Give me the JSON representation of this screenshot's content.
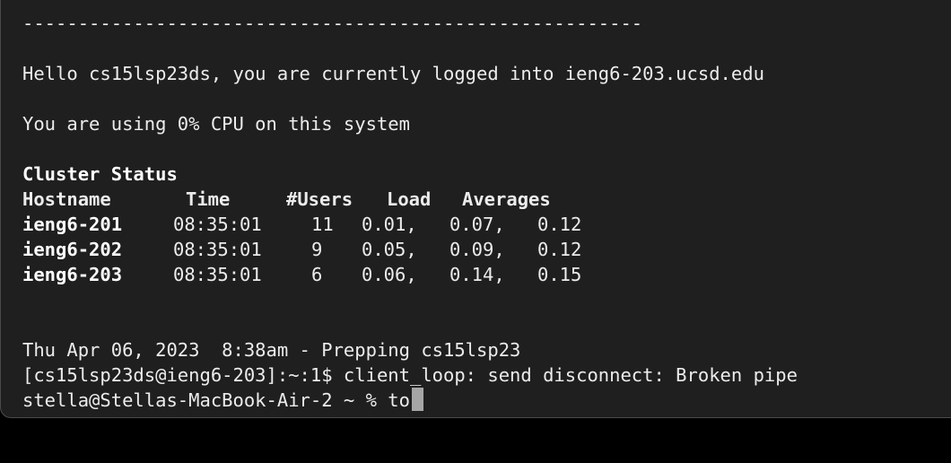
{
  "terminal": {
    "divider": "--------------------------------------------------------",
    "greeting": "Hello cs15lsp23ds, you are currently logged into ieng6-203.ucsd.edu",
    "cpu_usage": "You are using 0% CPU on this system",
    "cluster_title": "Cluster Status",
    "cluster_headers": {
      "hostname": "Hostname",
      "time": "Time",
      "users": "#Users",
      "load": "Load",
      "averages": "Averages"
    },
    "cluster_rows": [
      {
        "host": "ieng6-201",
        "time": "08:35:01",
        "users": "11",
        "load1": "0.01,",
        "load5": "0.07,",
        "load15": "0.12"
      },
      {
        "host": "ieng6-202",
        "time": "08:35:01",
        "users": "9",
        "load1": "0.05,",
        "load5": "0.09,",
        "load15": "0.12"
      },
      {
        "host": "ieng6-203",
        "time": "08:35:01",
        "users": "6",
        "load1": "0.06,",
        "load5": "0.14,",
        "load15": "0.15"
      }
    ],
    "date_line": "Thu Apr 06, 2023  8:38am - Prepping cs15lsp23",
    "disconnect_line": "[cs15lsp23ds@ieng6-203]:~:1$ client_loop: send disconnect: Broken pipe",
    "prompt": "stella@Stellas-MacBook-Air-2 ~ % ",
    "command_input": "to"
  },
  "colors": {
    "background": "#1f1f1f",
    "text": "#ececec",
    "cursor": "#a6a6a6"
  }
}
